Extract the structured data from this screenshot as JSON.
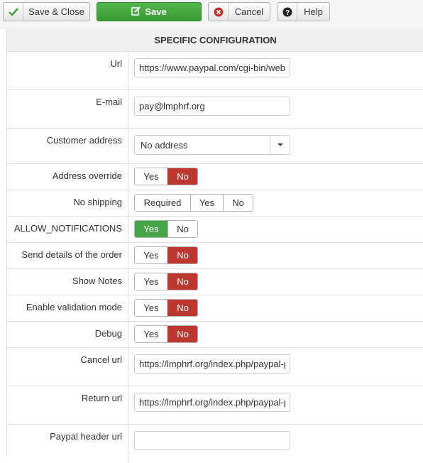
{
  "toolbar": {
    "save_close": "Save & Close",
    "save": "Save",
    "cancel": "Cancel",
    "help": "Help"
  },
  "panel": {
    "title": "SPECIFIC CONFIGURATION"
  },
  "fields": {
    "url": {
      "label": "Url",
      "value": "https://www.paypal.com/cgi-bin/web"
    },
    "email": {
      "label": "E-mail",
      "value": "pay@lmphrf.org"
    },
    "customer_address": {
      "label": "Customer address",
      "value": "No address"
    },
    "address_override": {
      "label": "Address override",
      "options": [
        "Yes",
        "No"
      ],
      "selected": "No"
    },
    "no_shipping": {
      "label": "No shipping",
      "options": [
        "Required",
        "Yes",
        "No"
      ],
      "selected": ""
    },
    "allow_notifications": {
      "label": "ALLOW_NOTIFICATIONS",
      "options": [
        "Yes",
        "No"
      ],
      "selected": "Yes"
    },
    "send_details": {
      "label": "Send details of the order",
      "options": [
        "Yes",
        "No"
      ],
      "selected": "No"
    },
    "show_notes": {
      "label": "Show Notes",
      "options": [
        "Yes",
        "No"
      ],
      "selected": "No"
    },
    "validation_mode": {
      "label": "Enable validation mode",
      "options": [
        "Yes",
        "No"
      ],
      "selected": "No"
    },
    "debug": {
      "label": "Debug",
      "options": [
        "Yes",
        "No"
      ],
      "selected": "No"
    },
    "cancel_url": {
      "label": "Cancel url",
      "value": "https://lmphrf.org/index.php/paypal-p"
    },
    "return_url": {
      "label": "Return url",
      "value": "https://lmphrf.org/index.php/paypal-p"
    },
    "header_url": {
      "label": "Paypal header url",
      "value": ""
    }
  },
  "colors": {
    "save_green": "#46a546",
    "no_red": "#bd362f",
    "yes_green": "#46a546"
  }
}
